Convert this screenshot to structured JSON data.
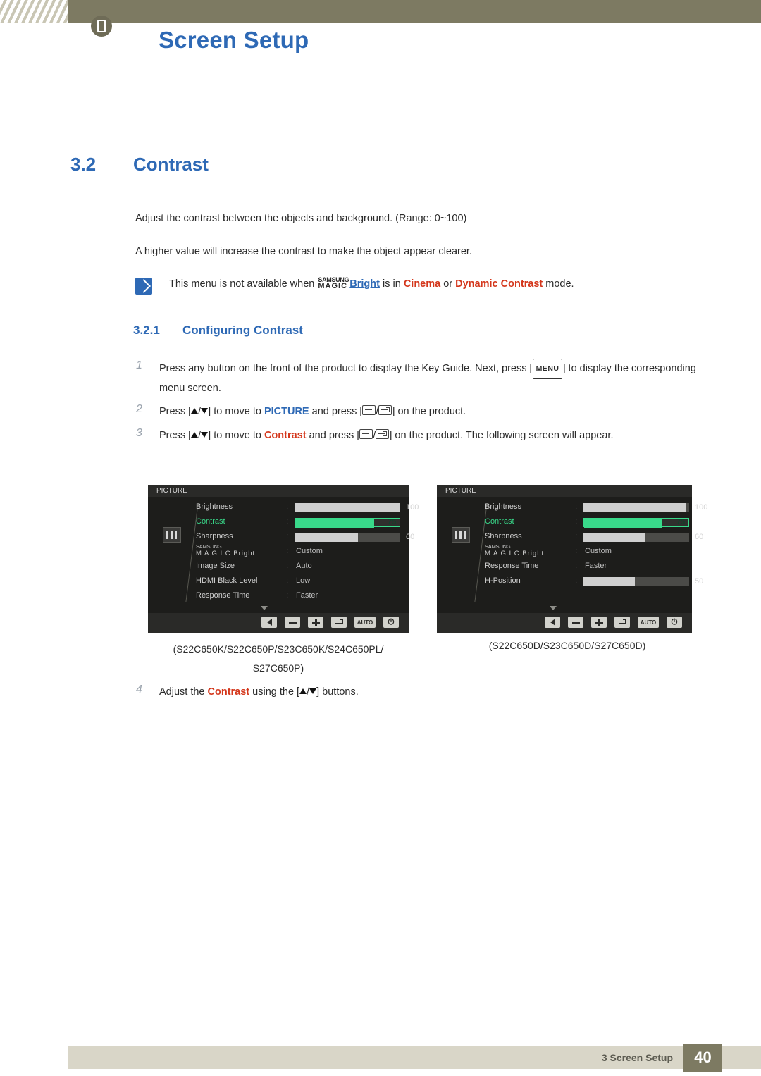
{
  "header": {
    "title": "Screen Setup",
    "icon": "monitor-icon"
  },
  "section": {
    "number": "3.2",
    "title": "Contrast"
  },
  "paragraphs": {
    "p1": "Adjust the contrast between the objects and background. (Range: 0~100)",
    "p2": "A higher value will increase the contrast to make the object appear clearer."
  },
  "note": {
    "icon": "note-icon",
    "prefix": "This menu is not available when ",
    "magic_samsung": "SAMSUNG",
    "magic_magic": "MAGIC",
    "bright": "Bright",
    "middle": " is in ",
    "mode1": "Cinema",
    "or": " or ",
    "mode2": "Dynamic Contrast",
    "suffix": " mode."
  },
  "subsection": {
    "number": "3.2.1",
    "title": "Configuring Contrast"
  },
  "steps": {
    "n1": "1",
    "n2": "2",
    "n3": "3",
    "n4": "4",
    "s1a": "Press any button on the front of the product to display the Key Guide. Next, press [",
    "s1_menu": "MENU",
    "s1b": "] to display the corresponding menu screen.",
    "s2a": "Press [",
    "s2b": "] to move to ",
    "s2_picture": "PICTURE",
    "s2c": " and press [",
    "s2d": "] on the product.",
    "s3a": "Press [",
    "s3b": "] to move to ",
    "s3_contrast": "Contrast",
    "s3c": " and press [",
    "s3d": "] on the product. The following screen will appear.",
    "s4a": "Adjust the ",
    "s4_contrast": "Contrast",
    "s4b": " using the [",
    "s4c": "] buttons."
  },
  "osd_left": {
    "title": "PICTURE",
    "rows": [
      {
        "label": "Brightness",
        "type": "bar",
        "fill": 100,
        "value": "100",
        "selected": false
      },
      {
        "label": "Contrast",
        "type": "bar-green",
        "fill": 75,
        "value": "75",
        "selected": true
      },
      {
        "label": "Sharpness",
        "type": "bar",
        "fill": 60,
        "value": "60",
        "selected": false
      },
      {
        "label": "MAGICBright",
        "type": "magic",
        "value": "Custom",
        "selected": false
      },
      {
        "label": "Image Size",
        "type": "text",
        "value": "Auto",
        "selected": false
      },
      {
        "label": "HDMI Black Level",
        "type": "text",
        "value": "Low",
        "selected": false
      },
      {
        "label": "Response Time",
        "type": "text",
        "value": "Faster",
        "selected": false
      }
    ],
    "magic_samsung": "SAMSUNG",
    "magic_magic": "M A G I C",
    "magic_bright": "Bright",
    "footer_auto": "AUTO"
  },
  "osd_right": {
    "title": "PICTURE",
    "rows": [
      {
        "label": "Brightness",
        "type": "bar",
        "fill": 100,
        "value": "100",
        "selected": false
      },
      {
        "label": "Contrast",
        "type": "bar-green",
        "fill": 75,
        "value": "75",
        "selected": true
      },
      {
        "label": "Sharpness",
        "type": "bar",
        "fill": 60,
        "value": "60",
        "selected": false
      },
      {
        "label": "MAGICBright",
        "type": "magic",
        "value": "Custom",
        "selected": false
      },
      {
        "label": "Response Time",
        "type": "text",
        "value": "Faster",
        "selected": false
      },
      {
        "label": "H-Position",
        "type": "bar",
        "fill": 50,
        "value": "50",
        "selected": false
      }
    ],
    "magic_samsung": "SAMSUNG",
    "magic_magic": "M A G I C",
    "magic_bright": "Bright",
    "footer_auto": "AUTO"
  },
  "captions": {
    "left": "(S22C650K/S22C650P/S23C650K/S24C650PL/ S27C650P)",
    "left_line1": "(S22C650K/S22C650P/S23C650K/S24C650PL/",
    "left_line2": "S27C650P)",
    "right": "(S22C650D/S23C650D/S27C650D)"
  },
  "footer": {
    "text": "3 Screen Setup",
    "page": "40"
  }
}
